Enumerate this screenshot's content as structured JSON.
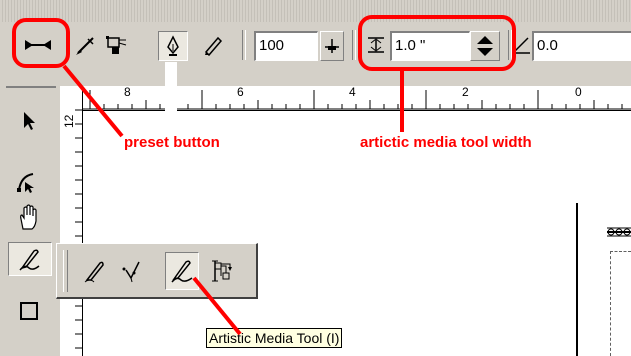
{
  "property_bar": {
    "zoom_value": "100",
    "width_value": "1.0 \"",
    "angle_value": "0.0"
  },
  "ruler": {
    "h_labels": [
      "8",
      "6",
      "4",
      "2",
      "0"
    ],
    "v_labels": [
      "12"
    ]
  },
  "flyout": {
    "tooltip": "Artistic Media Tool (I)"
  },
  "annotations": {
    "preset_button": "preset button",
    "width_label": "artictic media tool width"
  },
  "colors": {
    "annotation_red": "#ff0000",
    "face": "#d4d0c8"
  }
}
